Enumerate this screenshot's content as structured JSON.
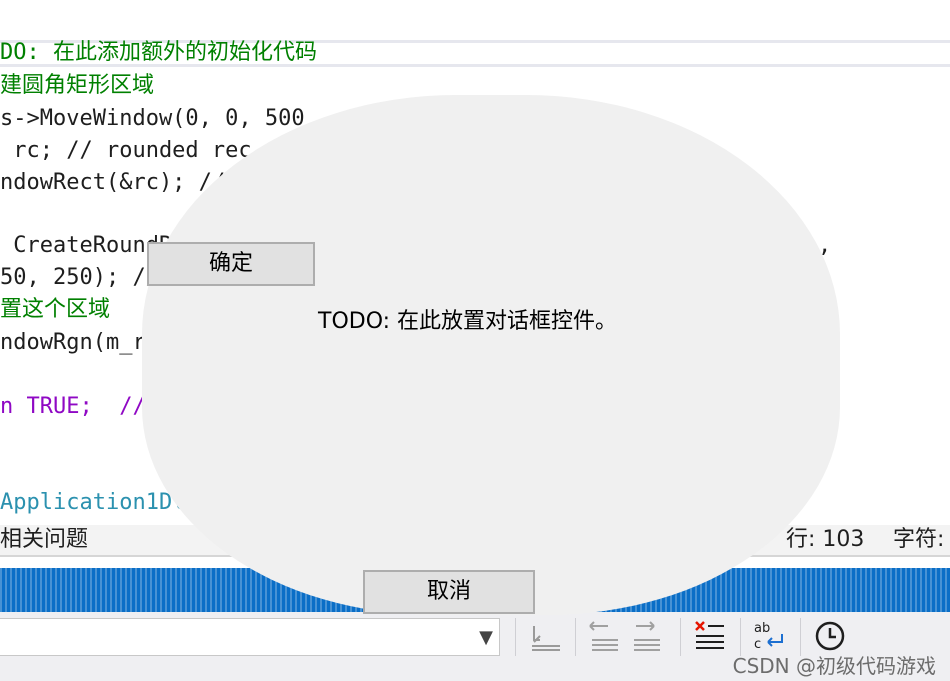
{
  "editor": {
    "lines": [
      {
        "text": "DO: 在此添加额外的初始化代码",
        "kind": "comment"
      },
      {
        "text": "建圆角矩形区域",
        "kind": "comment"
      },
      {
        "text": "s->MoveWindow(0, 0, 500",
        "kind": "code"
      },
      {
        "text": " rc; // rounded rec",
        "kind": "code"
      },
      {
        "text": "ndowRect(&rc); //",
        "kind": "code"
      },
      {
        "text": " CreateRoundR",
        "kind": "code"
      },
      {
        "text": "50, 250); //",
        "kind": "code"
      },
      {
        "text": "置这个区域",
        "kind": "comment"
      },
      {
        "text": "ndowRgn(m_rg",
        "kind": "code"
      },
      {
        "text": "n TRUE;  //",
        "kind": "keyword"
      },
      {
        "text": "Application1Dlg",
        "kind": "type"
      }
    ],
    "trailing_comma": ","
  },
  "statusbar": {
    "issues_label": "相关问题",
    "line_label": "行: 103",
    "char_label": "字符:"
  },
  "dialog": {
    "ok_label": "确定",
    "cancel_label": "取消",
    "todo_text": "TODO: 在此放置对话框控件。"
  },
  "toolbar": {
    "combo_value": "",
    "icons": [
      "bookmark-clear-icon",
      "outdent-icon",
      "indent-icon",
      "remove-lines-icon",
      "spell-check-icon",
      "history-clock-icon"
    ]
  },
  "watermark": "CSDN @初级代码游戏",
  "colors": {
    "comment": "#008000",
    "keyword": "#8f08c4",
    "type": "#2b91af",
    "dialog_bg": "#f0f0f0",
    "blue_band": "#0a6ec7"
  }
}
